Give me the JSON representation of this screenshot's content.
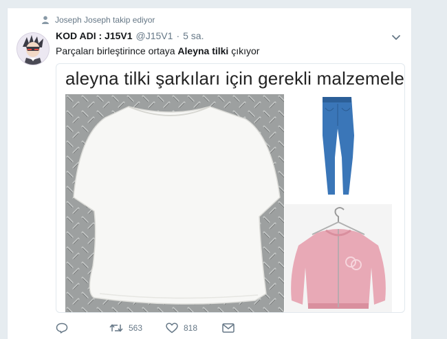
{
  "context": {
    "icon": "person-icon",
    "text": "Joseph Joseph takip ediyor"
  },
  "tweet": {
    "display_name": "KOD ADI : J15V1",
    "handle": "@J15V1",
    "separator": "·",
    "time": "5 sa.",
    "text_before": "Parçaları birleştirince ortaya ",
    "text_bold": "Aleyna tilki",
    "text_after": " çıkıyor"
  },
  "media": {
    "title": "aleyna tilki şarkıları için gerekli malzemeler"
  },
  "actions": {
    "reply_count": "",
    "retweet_count": "563",
    "like_count": "818"
  },
  "colors": {
    "background": "#e6ecf0",
    "card": "#ffffff",
    "muted": "#657786",
    "jeans": "#3a76b8",
    "jacket": "#e8a9b6"
  }
}
